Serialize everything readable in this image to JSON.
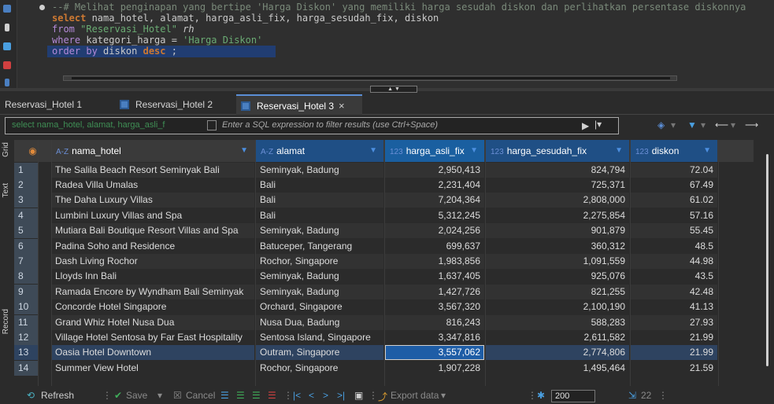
{
  "editor": {
    "comment": "--# Melihat penginapan yang bertipe 'Harga Diskon' yang memiliki harga sesudah diskon dan perlihatkan persentase diskonnya",
    "line2_kw": "select",
    "line2_rest": " nama_hotel, alamat, harga_asli_fix, harga_sesudah_fix, diskon",
    "line3_kw": "from",
    "line3_str": "\"Reservasi_Hotel\"",
    "line3_alias": "rh",
    "line4_kw": "where",
    "line4_rest": " kategori_harga = ",
    "line4_str": "'Harga Diskon'",
    "line5_kw": "order by",
    "line5_rest": " diskon ",
    "line5_kw2": "desc",
    "line5_end": " ;"
  },
  "tabs": [
    {
      "label": "Reservasi_Hotel 1"
    },
    {
      "label": "Reservasi_Hotel 2"
    },
    {
      "label": "Reservasi_Hotel 3",
      "close": "×"
    }
  ],
  "filter": {
    "query_text": "select nama_hotel, alamat, harga_asli_f",
    "placeholder": "Enter a SQL expression to filter results (use Ctrl+Space)"
  },
  "rail": {
    "grid_label": "Grid",
    "text_label": "Text",
    "record_label": "Record"
  },
  "columns": [
    {
      "type": "A-Z",
      "label": "nama_hotel"
    },
    {
      "type": "A-Z",
      "label": "alamat"
    },
    {
      "type": "123",
      "label": "harga_asli_fix"
    },
    {
      "type": "123",
      "label": "harga_sesudah_fix"
    },
    {
      "type": "123",
      "label": "diskon"
    }
  ],
  "rows": [
    {
      "no": "1",
      "nama": "The Salila Beach Resort Seminyak Bali",
      "alamat": "Seminyak, Badung",
      "asli": "2,950,413",
      "sesudah": "824,794",
      "diskon": "72.04"
    },
    {
      "no": "2",
      "nama": "Radea Villa Umalas",
      "alamat": "Bali",
      "asli": "2,231,404",
      "sesudah": "725,371",
      "diskon": "67.49"
    },
    {
      "no": "3",
      "nama": "The Daha Luxury Villas",
      "alamat": "Bali",
      "asli": "7,204,364",
      "sesudah": "2,808,000",
      "diskon": "61.02"
    },
    {
      "no": "4",
      "nama": "Lumbini Luxury Villas and Spa",
      "alamat": "Bali",
      "asli": "5,312,245",
      "sesudah": "2,275,854",
      "diskon": "57.16"
    },
    {
      "no": "5",
      "nama": "Mutiara Bali Boutique Resort Villas and Spa",
      "alamat": "Seminyak, Badung",
      "asli": "2,024,256",
      "sesudah": "901,879",
      "diskon": "55.45"
    },
    {
      "no": "6",
      "nama": "Padina Soho and Residence",
      "alamat": "Batuceper, Tangerang",
      "asli": "699,637",
      "sesudah": "360,312",
      "diskon": "48.5"
    },
    {
      "no": "7",
      "nama": "Dash Living Rochor",
      "alamat": "Rochor, Singapore",
      "asli": "1,983,856",
      "sesudah": "1,091,559",
      "diskon": "44.98"
    },
    {
      "no": "8",
      "nama": "Lloyds Inn Bali",
      "alamat": "Seminyak, Badung",
      "asli": "1,637,405",
      "sesudah": "925,076",
      "diskon": "43.5"
    },
    {
      "no": "9",
      "nama": "Ramada Encore by Wyndham Bali Seminyak",
      "alamat": "Seminyak, Badung",
      "asli": "1,427,726",
      "sesudah": "821,255",
      "diskon": "42.48"
    },
    {
      "no": "10",
      "nama": "Concorde Hotel Singapore",
      "alamat": "Orchard, Singapore",
      "asli": "3,567,320",
      "sesudah": "2,100,190",
      "diskon": "41.13"
    },
    {
      "no": "11",
      "nama": "Grand Whiz Hotel Nusa Dua",
      "alamat": "Nusa Dua, Badung",
      "asli": "816,243",
      "sesudah": "588,283",
      "diskon": "27.93"
    },
    {
      "no": "12",
      "nama": "Village Hotel Sentosa by Far East Hospitality",
      "alamat": "Sentosa Island, Singapore",
      "asli": "3,347,816",
      "sesudah": "2,611,582",
      "diskon": "21.99"
    },
    {
      "no": "13",
      "nama": "Oasia Hotel Downtown",
      "alamat": "Outram, Singapore",
      "asli": "3,557,062",
      "sesudah": "2,774,806",
      "diskon": "21.99"
    },
    {
      "no": "14",
      "nama": "Summer View Hotel",
      "alamat": "Rochor, Singapore",
      "asli": "1,907,228",
      "sesudah": "1,495,464",
      "diskon": "21.59"
    }
  ],
  "selected_row": 13,
  "toolbar": {
    "refresh": "Refresh",
    "save": "Save",
    "cancel": "Cancel",
    "export": "Export data",
    "page_size": "200",
    "count": "22"
  },
  "colors": {
    "accent": "#1e5da6",
    "background": "#2b2b2b",
    "header_num": "#1a5fa0"
  }
}
